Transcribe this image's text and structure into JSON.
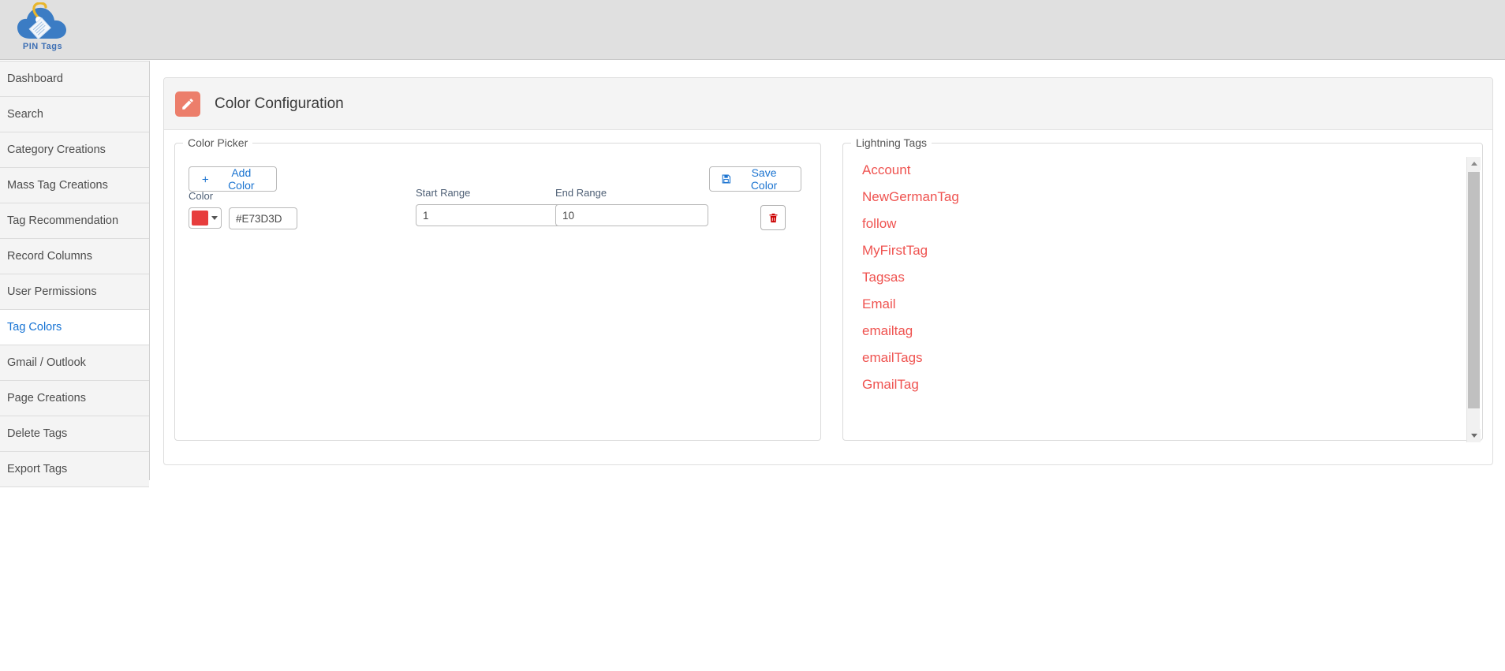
{
  "brand": {
    "logo_name": "pin-tags-logo",
    "name": "PIN Tags",
    "cloud_color": "#3b7cc4",
    "tag_color": "#e8b62c"
  },
  "sidebar": {
    "items": [
      {
        "label": "Dashboard",
        "active": false
      },
      {
        "label": "Search",
        "active": false
      },
      {
        "label": "Category Creations",
        "active": false
      },
      {
        "label": "Mass Tag Creations",
        "active": false
      },
      {
        "label": "Tag Recommendation",
        "active": false
      },
      {
        "label": "Record Columns",
        "active": false
      },
      {
        "label": "User Permissions",
        "active": false
      },
      {
        "label": "Tag Colors",
        "active": true
      },
      {
        "label": "Gmail / Outlook",
        "active": false
      },
      {
        "label": "Page Creations",
        "active": false
      },
      {
        "label": "Delete Tags",
        "active": false
      },
      {
        "label": "Export Tags",
        "active": false
      }
    ]
  },
  "card": {
    "title": "Color Configuration",
    "icon": "pencil-icon",
    "icon_bg": "#ec7e6b"
  },
  "color_picker": {
    "legend": "Color Picker",
    "add_color_label": "Add Color",
    "save_color_label": "Save Color",
    "labels": {
      "color": "Color",
      "start_range": "Start Range",
      "end_range": "End Range"
    },
    "rows": [
      {
        "swatch": "#E73D3D",
        "hex_value": "#E73D3D",
        "hex_placeholder": "#FFFFFF",
        "start_range": "1",
        "start_range_placeholder": "",
        "end_range": "10",
        "end_range_placeholder": "",
        "delete_icon": "trash-icon",
        "delete_icon_color": "#cc0000"
      }
    ]
  },
  "lightning_tags": {
    "legend": "Lightning Tags",
    "text_color": "#ef5350",
    "items": [
      "Account",
      "NewGermanTag",
      "follow",
      "MyFirstTag",
      "Tagsas",
      "Email",
      "emailtag",
      "emailTags",
      "GmailTag"
    ],
    "scrollbar": {
      "up_icon": "scroll-up-arrow-icon",
      "down_icon": "scroll-down-arrow-icon"
    }
  }
}
